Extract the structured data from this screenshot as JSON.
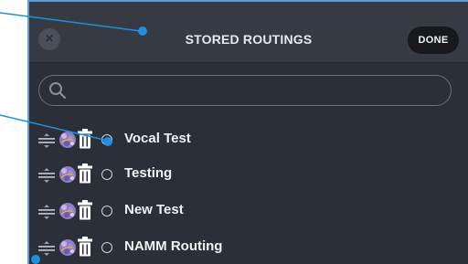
{
  "header": {
    "title": "STORED ROUTINGS",
    "done_label": "DONE",
    "close_glyph": "×"
  },
  "search": {
    "placeholder": "",
    "value": ""
  },
  "routings": [
    {
      "name": "Vocal Test",
      "selected": true
    },
    {
      "name": "Testing",
      "selected": false
    },
    {
      "name": "New Test",
      "selected": false
    },
    {
      "name": "NAMM Routing",
      "selected": false
    }
  ],
  "colors": {
    "accent": "#1f8fe0",
    "panel": "#2b2f37",
    "header": "#353a43",
    "done": "#17191d"
  }
}
